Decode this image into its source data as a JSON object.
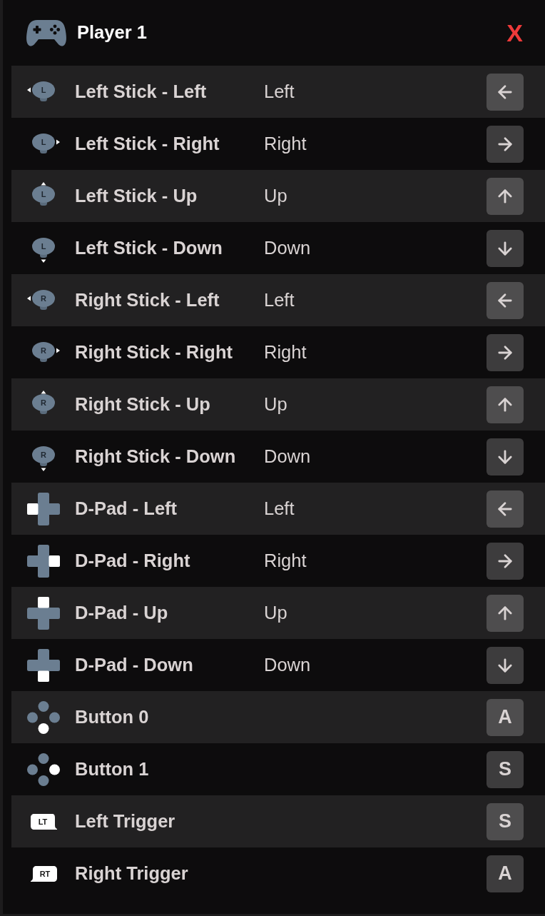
{
  "header": {
    "title": "Player 1",
    "close_label": "X"
  },
  "bindings": [
    {
      "kind": "stick",
      "icon_label": "L",
      "highlight": {
        "kind": "left"
      },
      "name": "Left Stick - Left",
      "value": "Left",
      "key": {
        "kind": "left"
      }
    },
    {
      "kind": "stick",
      "icon_label": "L",
      "highlight": {
        "kind": "right"
      },
      "name": "Left Stick - Right",
      "value": "Right",
      "key": {
        "kind": "right"
      }
    },
    {
      "kind": "stick",
      "icon_label": "L",
      "highlight": {
        "kind": "up"
      },
      "name": "Left Stick - Up",
      "value": "Up",
      "key": {
        "kind": "up"
      }
    },
    {
      "kind": "stick",
      "icon_label": "L",
      "highlight": {
        "kind": "down"
      },
      "name": "Left Stick - Down",
      "value": "Down",
      "key": {
        "kind": "down"
      }
    },
    {
      "kind": "stick",
      "icon_label": "R",
      "highlight": {
        "kind": "left"
      },
      "name": "Right Stick - Left",
      "value": "Left",
      "key": {
        "kind": "left"
      }
    },
    {
      "kind": "stick",
      "icon_label": "R",
      "highlight": {
        "kind": "right"
      },
      "name": "Right Stick - Right",
      "value": "Right",
      "key": {
        "kind": "right"
      }
    },
    {
      "kind": "stick",
      "icon_label": "R",
      "highlight": {
        "kind": "up"
      },
      "name": "Right Stick - Up",
      "value": "Up",
      "key": {
        "kind": "up"
      }
    },
    {
      "kind": "stick",
      "icon_label": "R",
      "highlight": {
        "kind": "down"
      },
      "name": "Right Stick - Down",
      "value": "Down",
      "key": {
        "kind": "down"
      }
    },
    {
      "kind": "dpad",
      "highlight": {
        "kind": "left"
      },
      "name": "D-Pad - Left",
      "value": "Left",
      "key": {
        "kind": "left"
      }
    },
    {
      "kind": "dpad",
      "highlight": {
        "kind": "right"
      },
      "name": "D-Pad - Right",
      "value": "Right",
      "key": {
        "kind": "right"
      }
    },
    {
      "kind": "dpad",
      "highlight": {
        "kind": "up"
      },
      "name": "D-Pad - Up",
      "value": "Up",
      "key": {
        "kind": "up"
      }
    },
    {
      "kind": "dpad",
      "highlight": {
        "kind": "down"
      },
      "name": "D-Pad - Down",
      "value": "Down",
      "key": {
        "kind": "down"
      }
    },
    {
      "kind": "button",
      "highlight": {
        "kind": "down"
      },
      "name": "Button 0",
      "key": {
        "kind": "letter",
        "label": "A"
      }
    },
    {
      "kind": "button",
      "highlight": {
        "kind": "right"
      },
      "name": "Button 1",
      "key": {
        "kind": "letter",
        "label": "S"
      }
    },
    {
      "kind": "trigger",
      "icon_label": "LT",
      "tail": {
        "kind": "right"
      },
      "name": "Left Trigger",
      "key": {
        "kind": "letter",
        "label": "S"
      }
    },
    {
      "kind": "trigger",
      "icon_label": "RT",
      "tail": {
        "kind": "left"
      },
      "name": "Right Trigger",
      "key": {
        "kind": "letter",
        "label": "A"
      }
    }
  ]
}
